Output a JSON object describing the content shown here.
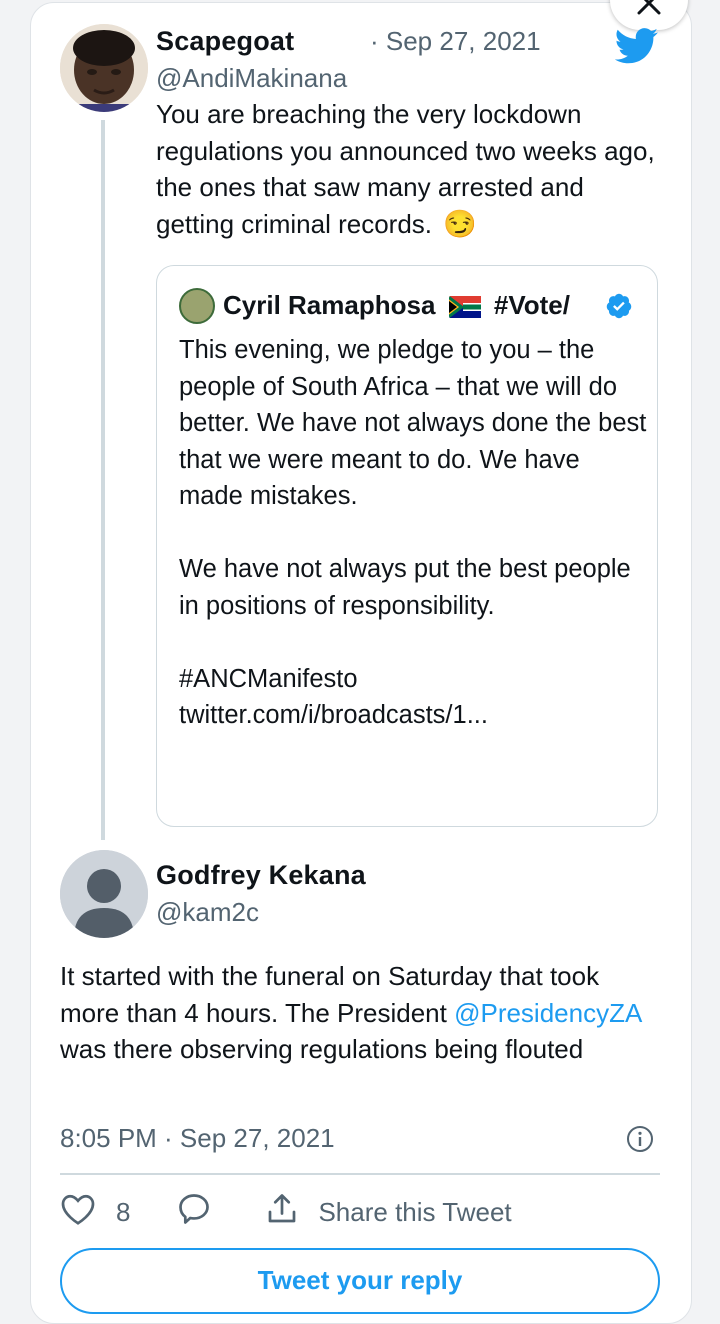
{
  "reply_tweet": {
    "display_name": "Scapegoat",
    "date": "· Sep 27, 2021",
    "handle": "@AndiMakinana",
    "text": "You are breaching the very lockdown regulations you announced two weeks ago, the ones that saw many arrested and getting criminal records.",
    "emoji": "😏"
  },
  "quoted_tweet": {
    "display_name": "Cyril Ramaphosa",
    "name_suffix": "#Vote/",
    "text": "This evening, we pledge to you – the people of South Africa – that we will do better. We have not always done the best that we were meant to do. We have made mistakes.\n\nWe have not always put the best people in positions of responsibility.\n\n#ANCManifesto\ntwitter.com/i/broadcasts/1..."
  },
  "main_tweet": {
    "display_name": "Godfrey Kekana",
    "handle": "@kam2c",
    "text_part1": "It started with the funeral on Saturday that took more than 4 hours. The President ",
    "mention": "@PresidencyZA",
    "text_part2": " was there observing regulations being flouted",
    "timestamp": "8:05 PM · Sep 27, 2021"
  },
  "actions": {
    "like_count": "8",
    "share_label": "Share this Tweet"
  },
  "reply_button_label": "Tweet your reply",
  "colors": {
    "accent": "#1d9bf0",
    "muted": "#536471",
    "border": "#cfd9de"
  },
  "icons": [
    "close-icon",
    "twitter-bird-icon",
    "verified-badge-icon",
    "sa-flag-icon",
    "info-icon",
    "heart-icon",
    "reply-bubble-icon",
    "share-icon"
  ]
}
